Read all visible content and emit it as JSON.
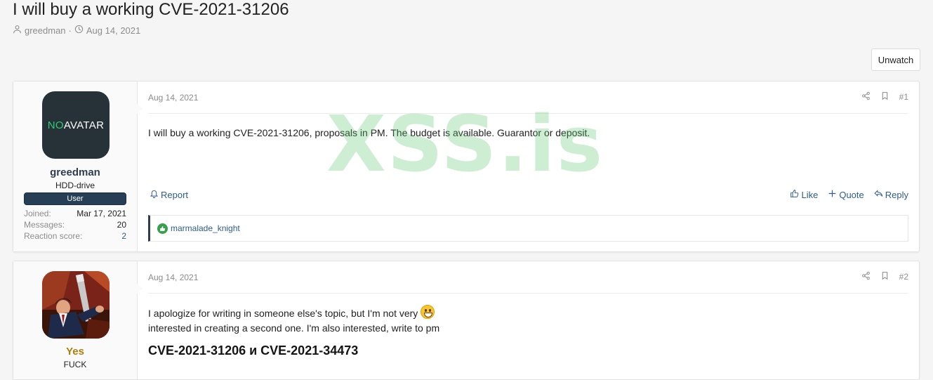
{
  "thread": {
    "title": "I will buy a working CVE-2021-31206",
    "author": "greedman",
    "separator": "·",
    "date": "Aug 14, 2021",
    "unwatch_label": "Unwatch"
  },
  "watermark": "XSS.is",
  "posts": [
    {
      "user": {
        "name": "greedman",
        "avatar_no": "NO",
        "avatar_text": "AVATAR",
        "title": "HDD-drive",
        "banner": "User",
        "stats": [
          {
            "label": "Joined:",
            "value": "Mar 17, 2021"
          },
          {
            "label": "Messages:",
            "value": "20"
          },
          {
            "label": "Reaction score:",
            "value": "2"
          }
        ]
      },
      "date": "Aug 14, 2021",
      "number": "#1",
      "body": "I will buy a working CVE-2021-31206, proposals in PM. The budget is available. Guarantor or deposit.",
      "actions": {
        "report": "Report",
        "like": "Like",
        "quote": "Quote",
        "reply": "Reply"
      },
      "reactions": "marmalade_knight"
    },
    {
      "user": {
        "name": "Yes",
        "title": "FUCK"
      },
      "date": "Aug 14, 2021",
      "number": "#2",
      "body_line1": "I apologize for writing in someone else's topic, but I'm not very",
      "body_line2": "interested in creating a second one. I'm also interested, write to pm",
      "heading": "CVE-2021-31206 и CVE-2021-34473"
    }
  ],
  "colors": {
    "accent": "#2f5b8f",
    "like": "#39a04a",
    "username2": "#b07d0d"
  }
}
